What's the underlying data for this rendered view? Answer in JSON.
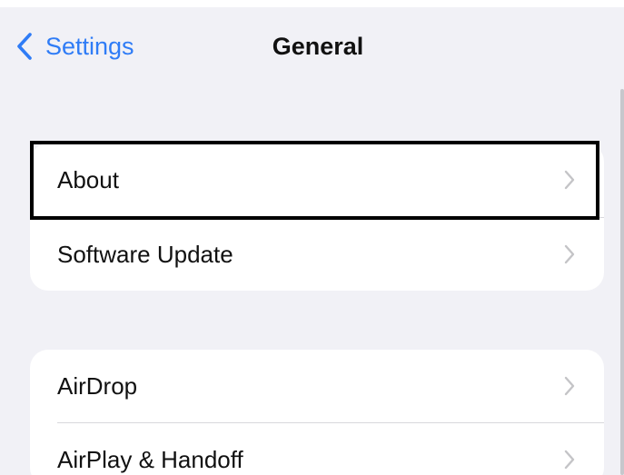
{
  "nav": {
    "back_label": "Settings",
    "title": "General"
  },
  "icons": {
    "back": "chevron-left-icon",
    "disclosure": "chevron-right-icon"
  },
  "colors": {
    "accent": "#2f7cf6",
    "background": "#f1f1f6",
    "chevron": "#c4c4c7"
  },
  "groups": [
    {
      "rows": [
        {
          "label": "About",
          "highlighted": true
        },
        {
          "label": "Software Update"
        }
      ]
    },
    {
      "rows": [
        {
          "label": "AirDrop"
        },
        {
          "label": "AirPlay & Handoff"
        }
      ]
    }
  ]
}
